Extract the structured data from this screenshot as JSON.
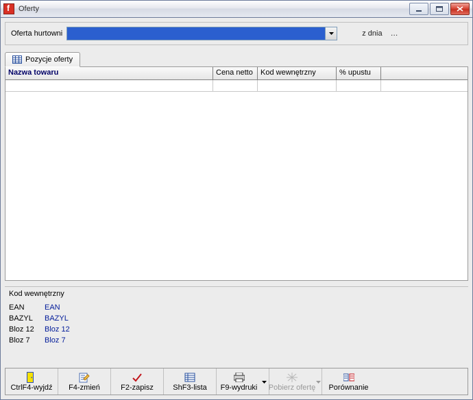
{
  "window": {
    "title": "Oferty"
  },
  "filter": {
    "label": "Oferta hurtowni",
    "combo_value": "",
    "date_label": "z dnia",
    "date_value": "…"
  },
  "tabs": {
    "positions": "Pozycje oferty"
  },
  "grid": {
    "headers": [
      "Nazwa towaru",
      "Cena netto",
      "Kod wewnętrzny",
      "% upustu"
    ]
  },
  "codes": {
    "title": "Kod wewnętrzny",
    "rows": [
      {
        "label": "EAN",
        "value": "EAN"
      },
      {
        "label": "BAZYL",
        "value": "BAZYL"
      },
      {
        "label": "Bloz 12",
        "value": "Bloz 12"
      },
      {
        "label": "Bloz 7",
        "value": "Bloz 7"
      }
    ]
  },
  "buttons": {
    "exit": "CtrlF4-wyjdź",
    "change": "F4-zmień",
    "save": "F2-zapisz",
    "list": "ShF3-lista",
    "print": "F9-wydruki",
    "fetch": "Pobierz ofertę",
    "compare": "Porównanie"
  }
}
